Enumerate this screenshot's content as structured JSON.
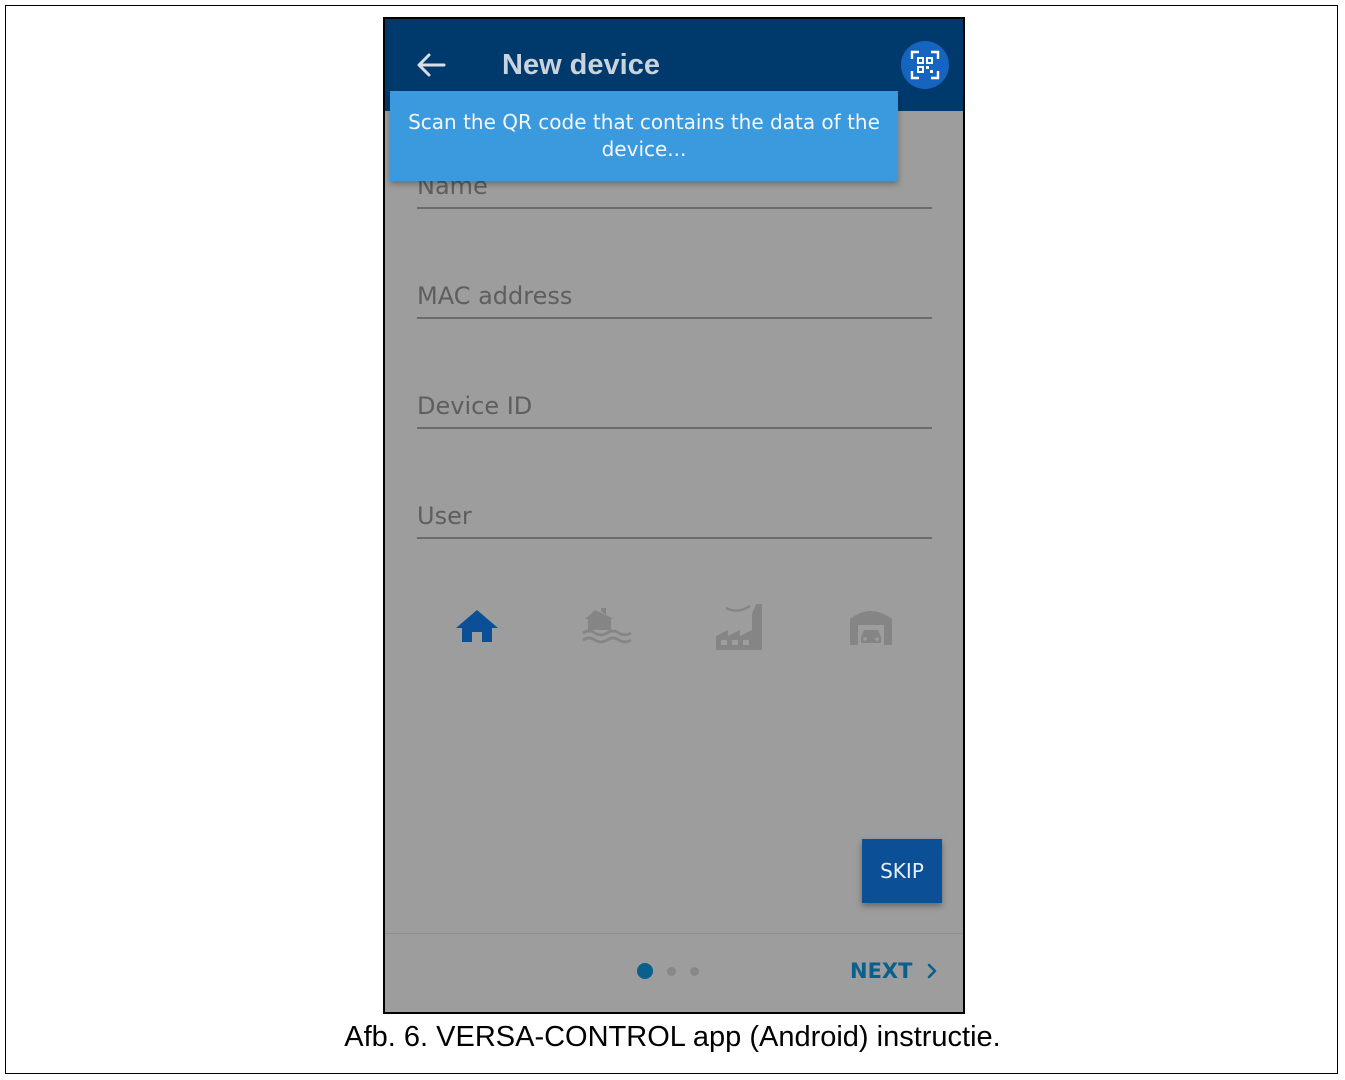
{
  "header": {
    "title": "New device",
    "back_icon": "arrow-left-icon",
    "qr_icon": "qr-code-icon"
  },
  "tooltip": {
    "text": "Scan the QR code that contains the data of the device..."
  },
  "form": {
    "name": {
      "placeholder": "Name",
      "value": ""
    },
    "mac": {
      "placeholder": "MAC address",
      "value": ""
    },
    "device_id": {
      "placeholder": "Device ID",
      "value": ""
    },
    "user": {
      "placeholder": "User",
      "value": ""
    }
  },
  "device_types": [
    {
      "icon": "home-icon",
      "selected": true
    },
    {
      "icon": "lake-house-icon",
      "selected": false
    },
    {
      "icon": "factory-icon",
      "selected": false
    },
    {
      "icon": "garage-icon",
      "selected": false
    }
  ],
  "buttons": {
    "skip": "SKIP",
    "next": "NEXT"
  },
  "pager": {
    "total": 3,
    "current": 1
  },
  "caption": "Afb. 6. VERSA-CONTROL app (Android) instructie.",
  "colors": {
    "appbar": "#003a6d",
    "overlay": "#9d9d9d",
    "tooltip": "#3b9ade",
    "selected_icon": "#0b4f96",
    "unselected_icon": "#858585",
    "skip_button": "#0b4f96",
    "accent": "#0a5f8c"
  }
}
